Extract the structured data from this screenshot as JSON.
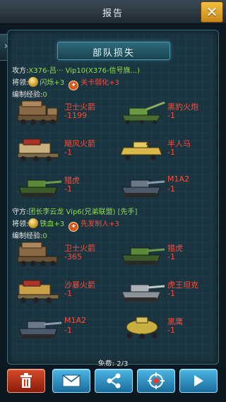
{
  "header": {
    "title": "报告",
    "close_label": "✕"
  },
  "panel": {
    "section_title": "部队损失"
  },
  "attacker": {
    "prefix": "攻方:",
    "name": "X376-吕",
    "name_rest": "··· Vip10(X376-信号旗...)",
    "general_label": "将领:",
    "general": "闪烁+3",
    "skill": "关卡弱化+3",
    "exp_label": "编制经验:",
    "exp_value": "0",
    "units": [
      {
        "name": "卫士火箭",
        "loss": "-1199"
      },
      {
        "name": "黑豹火炮",
        "loss": "-1"
      },
      {
        "name": "飓风火箭",
        "loss": "-1"
      },
      {
        "name": "半人马",
        "loss": "-1"
      },
      {
        "name": "猎虎",
        "loss": "-1"
      },
      {
        "name": "M1A2",
        "loss": "-1"
      }
    ]
  },
  "defender": {
    "prefix": "守方:",
    "name": "团长李云龙 Vip6(兄弟联盟) [先手]",
    "general_label": "将领:",
    "general": "铁血+3",
    "skill": "先发制人+3",
    "exp_label": "编制经验:",
    "exp_value": "0",
    "units": [
      {
        "name": "卫士火箭",
        "loss": "-365"
      },
      {
        "name": "猎虎",
        "loss": "-1"
      },
      {
        "name": "沙暴火箭",
        "loss": "-1"
      },
      {
        "name": "虎王坦克",
        "loss": "-1"
      },
      {
        "name": "M1A2",
        "loss": "-1"
      },
      {
        "name": "黑鹰",
        "loss": "-1"
      }
    ]
  },
  "footer": {
    "free_text": "免费: 2/3"
  },
  "toolbar": {
    "buttons": [
      "trash-icon",
      "mail-icon",
      "share-icon",
      "target-icon",
      "play-icon"
    ]
  },
  "colors": {
    "loss_red": "#ff4a3a",
    "highlight_green": "#8ee04a",
    "close_gold": "#f4c040"
  }
}
